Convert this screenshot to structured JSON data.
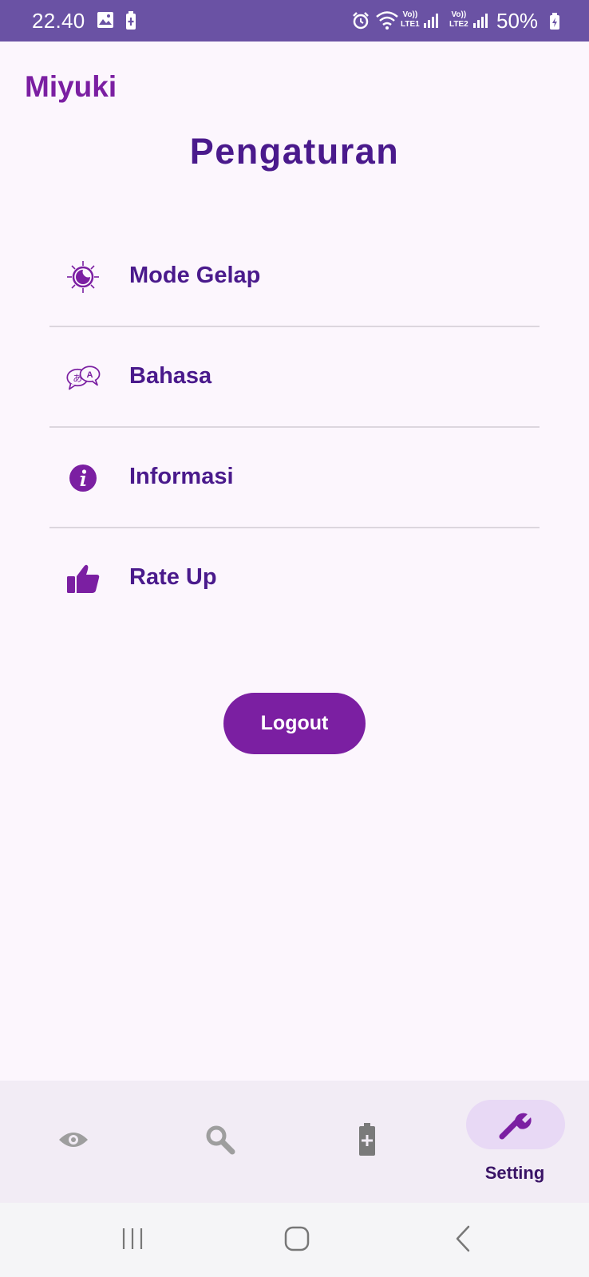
{
  "status_bar": {
    "time": "22.40",
    "battery_percent": "50%",
    "lte1": "LTE1",
    "lte2": "LTE2",
    "volte": "Vo))",
    "icons": [
      "gallery-icon",
      "battery-saver-icon",
      "alarm-icon",
      "wifi-icon",
      "signal-icon",
      "battery-icon"
    ]
  },
  "app": {
    "name": "Miyuki"
  },
  "page": {
    "title": "Pengaturan"
  },
  "settings_menu": {
    "items": [
      {
        "label": "Mode Gelap",
        "icon": "dark-mode-icon"
      },
      {
        "label": "Bahasa",
        "icon": "translate-icon"
      },
      {
        "label": "Informasi",
        "icon": "info-icon"
      },
      {
        "label": "Rate Up",
        "icon": "thumbs-up-icon"
      }
    ]
  },
  "logout": {
    "label": "Logout"
  },
  "bottom_nav": {
    "tabs": [
      {
        "icon": "eye-icon",
        "active": false
      },
      {
        "icon": "search-icon",
        "active": false
      },
      {
        "icon": "battery-icon",
        "active": false
      },
      {
        "icon": "wrench-icon",
        "label": "Setting",
        "active": true
      }
    ]
  },
  "system_nav": {
    "buttons": [
      "recents-icon",
      "home-icon",
      "back-icon"
    ]
  },
  "colors": {
    "status_bar": "#6a52a4",
    "background": "#fcf6fd",
    "primary": "#7b1fa2",
    "title_text": "#4a1a8c",
    "divider": "#dcd6de",
    "nav_background": "#f2ecf5",
    "nav_active_pill": "#e8d9f5",
    "nav_inactive_icon": "#9e9e9e"
  }
}
